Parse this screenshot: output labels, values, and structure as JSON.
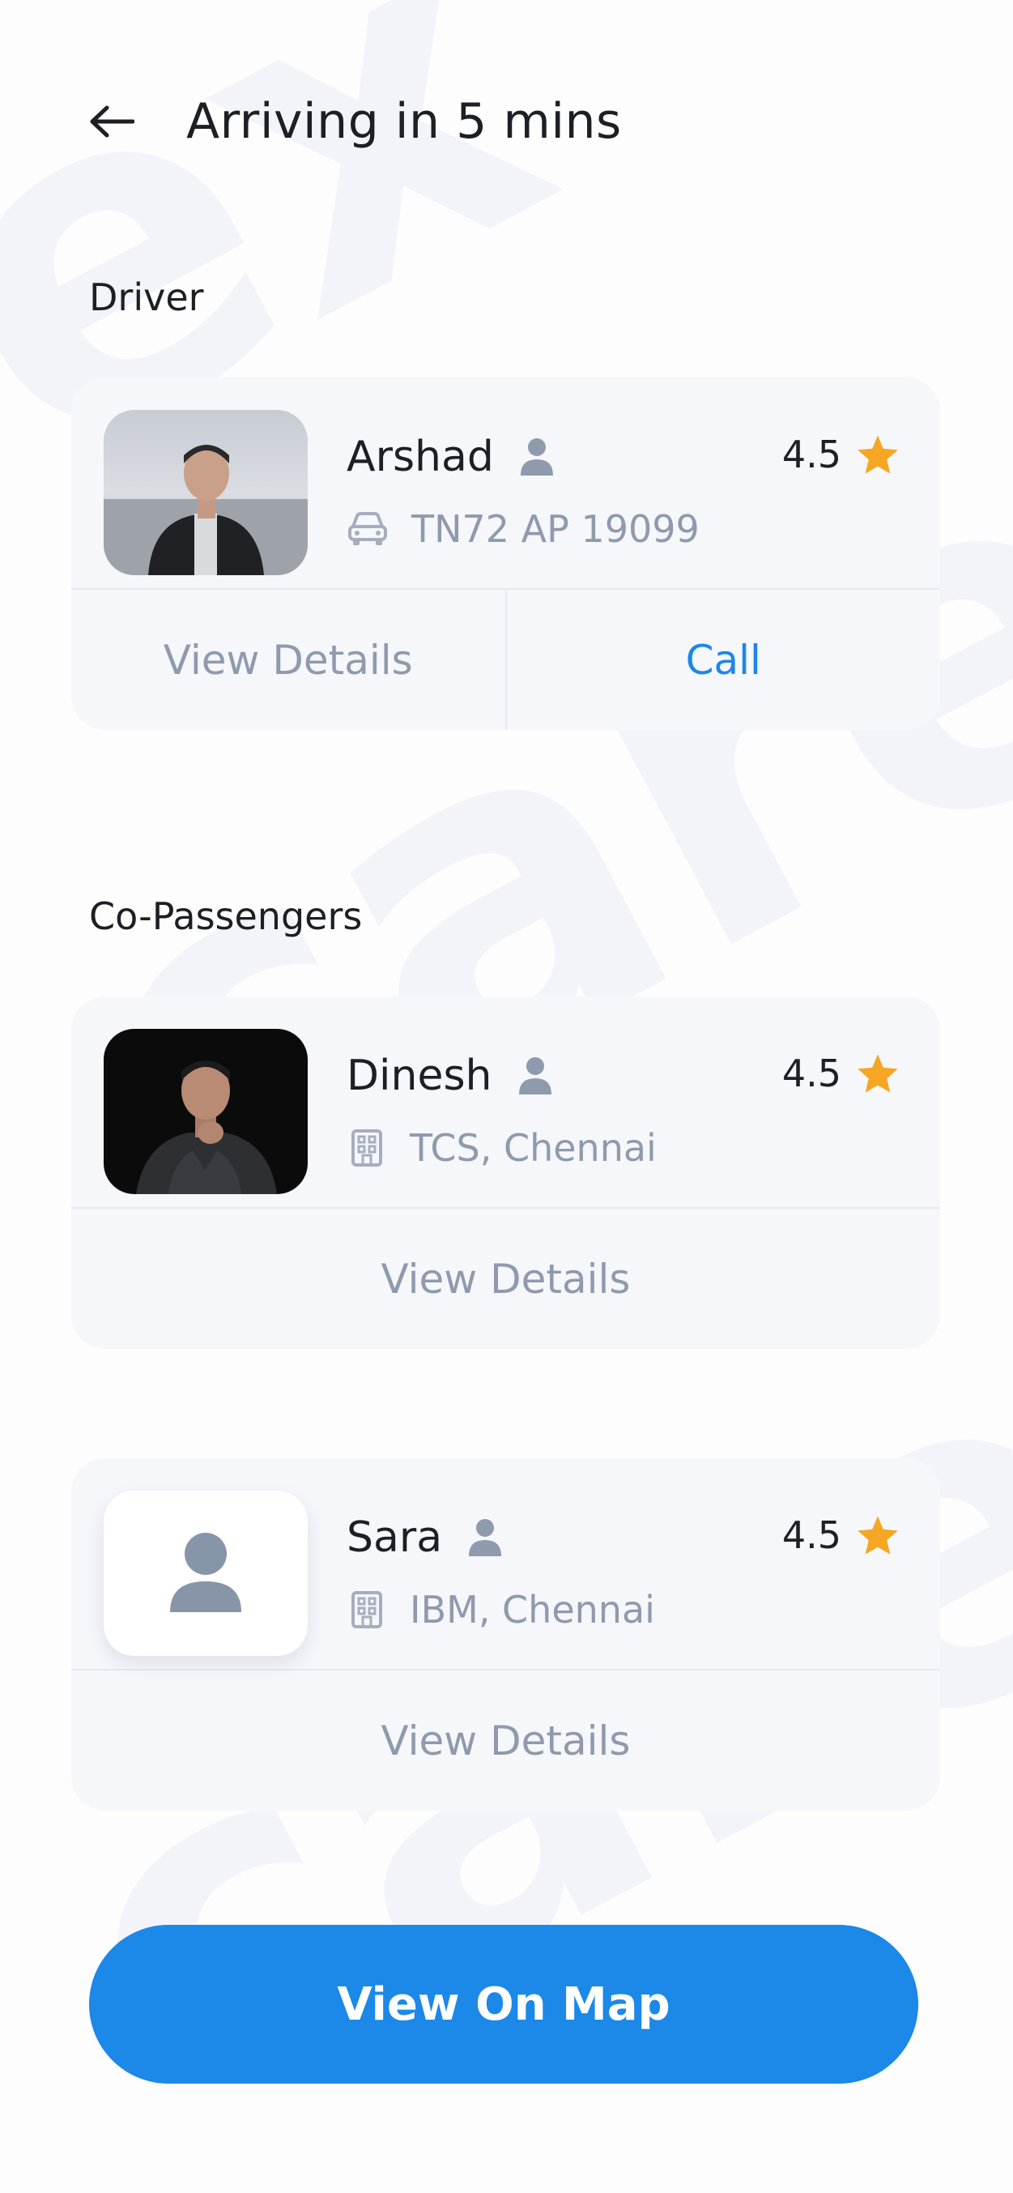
{
  "header": {
    "title": "Arriving in 5 mins"
  },
  "driver": {
    "section_title": "Driver",
    "name": "Arshad",
    "rating": "4.5",
    "vehicle_number": "TN72 AP 19099",
    "view_details_label": "View Details",
    "call_label": "Call"
  },
  "co_passengers": {
    "section_title": "Co-Passengers",
    "items": [
      {
        "name": "Dinesh",
        "rating": "4.5",
        "company": "TCS, Chennai",
        "view_details_label": "View Details"
      },
      {
        "name": "Sara",
        "rating": "4.5",
        "company": "IBM, Chennai",
        "view_details_label": "View Details"
      }
    ]
  },
  "map_button": {
    "label": "View On Map"
  },
  "watermark": {
    "text": "carex"
  },
  "colors": {
    "accent": "#1c88e8",
    "star": "#f5a623",
    "muted": "#8f9aac",
    "card_bg": "#f5f7fb"
  },
  "icons": [
    "back-arrow-icon",
    "user-icon",
    "car-icon",
    "building-icon",
    "star-icon",
    "avatar-placeholder-icon"
  ]
}
